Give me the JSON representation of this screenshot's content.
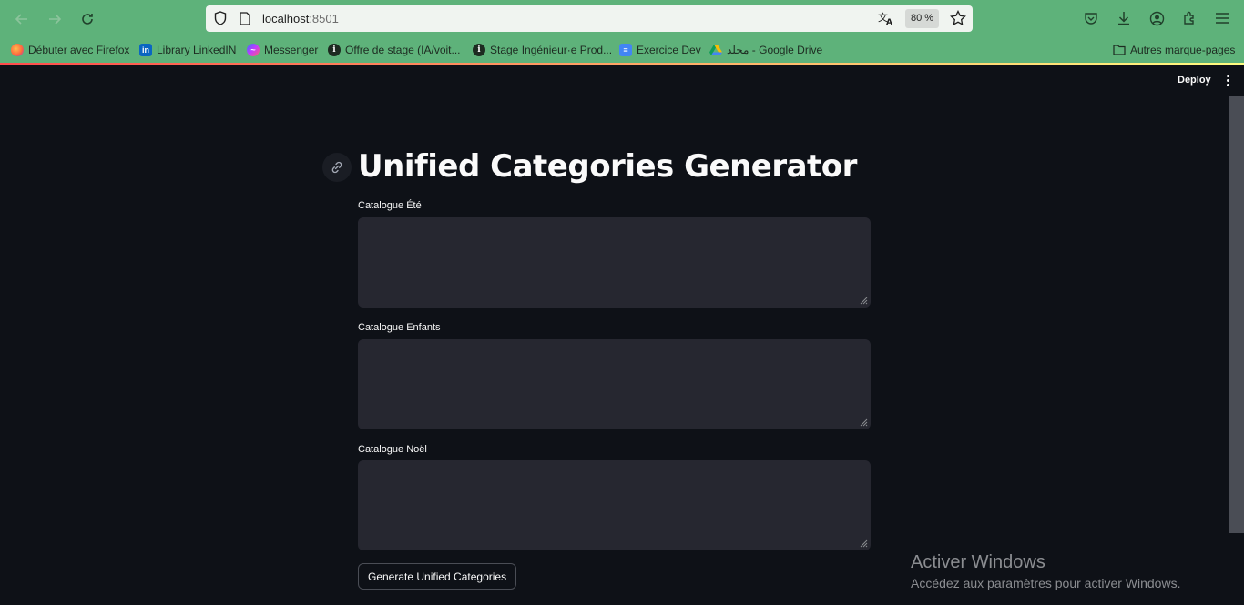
{
  "browser": {
    "url_host": "localhost",
    "url_port": ":8501",
    "zoom": "80 %",
    "bookmarks": [
      {
        "label": "Débuter avec Firefox",
        "icon": "firefox-icon"
      },
      {
        "label": "Library LinkedIN",
        "icon": "linkedin-icon"
      },
      {
        "label": "Messenger",
        "icon": "messenger-icon"
      },
      {
        "label": "Offre de stage (IA/voit...",
        "icon": "info-icon"
      },
      {
        "label": "Stage Ingénieur·e Prod...",
        "icon": "info-icon"
      },
      {
        "label": "Exercice Dev",
        "icon": "docs-icon"
      },
      {
        "label": "مجلد - Google Drive",
        "icon": "drive-icon"
      },
      {
        "label": "Autres marque-pages",
        "icon": "folder-icon"
      }
    ]
  },
  "app": {
    "deploy_label": "Deploy",
    "title": "Unified Categories Generator",
    "fields": [
      {
        "label": "Catalogue Été",
        "value": ""
      },
      {
        "label": "Catalogue Enfants",
        "value": ""
      },
      {
        "label": "Catalogue Noël",
        "value": ""
      }
    ],
    "generate_button": "Generate Unified Categories"
  },
  "os_overlay": {
    "title": "Activer Windows",
    "subtitle": "Accédez aux paramètres pour activer Windows."
  },
  "colors": {
    "browser_chrome": "#5eb27a",
    "app_background": "#0e1117",
    "input_background": "#262730",
    "text": "#fafafa"
  }
}
